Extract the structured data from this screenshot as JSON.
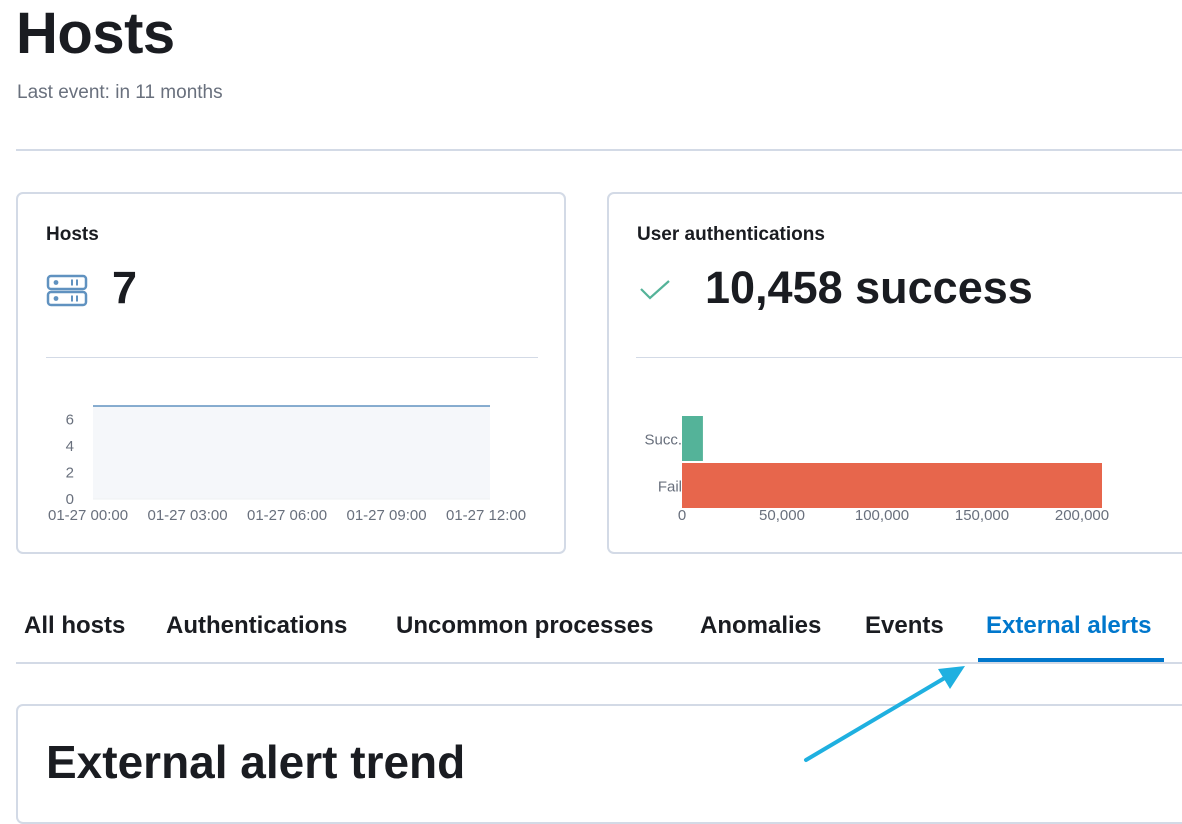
{
  "page": {
    "title": "Hosts",
    "last_event": "Last event: in 11 months"
  },
  "hosts_panel": {
    "title": "Hosts",
    "icon": "server-icon",
    "value": "7"
  },
  "auth_panel": {
    "title": "User authentications",
    "icon": "check-icon",
    "value": "10,458 success"
  },
  "tabs": [
    {
      "label": "All hosts",
      "active": false
    },
    {
      "label": "Authentications",
      "active": false
    },
    {
      "label": "Uncommon processes",
      "active": false
    },
    {
      "label": "Anomalies",
      "active": false
    },
    {
      "label": "Events",
      "active": false
    },
    {
      "label": "External alerts",
      "active": true
    }
  ],
  "trend_panel": {
    "title": "External alert trend"
  },
  "colors": {
    "accent": "#0077cc",
    "success": "#54b399",
    "fail": "#e7664c",
    "line": "#6092c0",
    "annotation_arrow": "#1fb0e0"
  },
  "chart_data": [
    {
      "type": "area",
      "x": [
        "01-27 00:00",
        "01-27 03:00",
        "01-27 06:00",
        "01-27 09:00",
        "01-27 12:00"
      ],
      "series": [
        {
          "values": [
            7,
            7,
            7,
            7,
            7
          ]
        }
      ],
      "yticks": [
        "0",
        "2",
        "4",
        "6"
      ],
      "ylim": [
        0,
        7
      ]
    },
    {
      "type": "bar",
      "orientation": "horizontal",
      "categories": [
        "Succ.",
        "Fail"
      ],
      "values": [
        10458,
        210000
      ],
      "colors": [
        "#54b399",
        "#e7664c"
      ],
      "xticks": [
        "0",
        "50,000",
        "100,000",
        "150,000",
        "200,000"
      ],
      "xlim": [
        0,
        200000
      ]
    }
  ]
}
